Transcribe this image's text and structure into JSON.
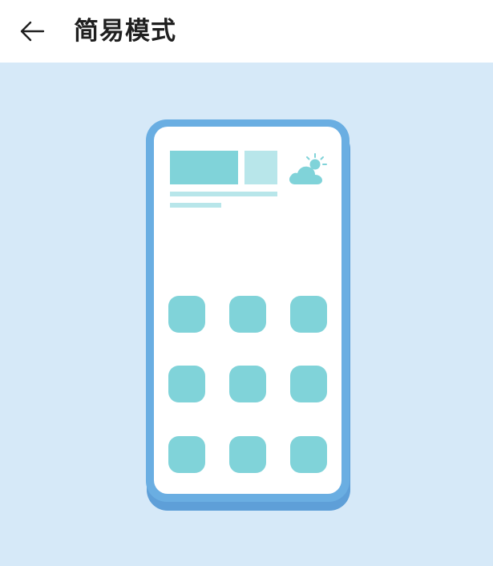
{
  "header": {
    "back_icon": "arrow-left-icon",
    "title": "简易模式"
  },
  "illustration": {
    "weather_icon": "cloud-sun-icon",
    "app_grid": {
      "rows": 3,
      "columns": 3
    }
  },
  "colors": {
    "background": "#d6e9f8",
    "phone_frame": "#6aaee2",
    "accent": "#80d3d9",
    "accent_light": "#b8e6ea"
  }
}
